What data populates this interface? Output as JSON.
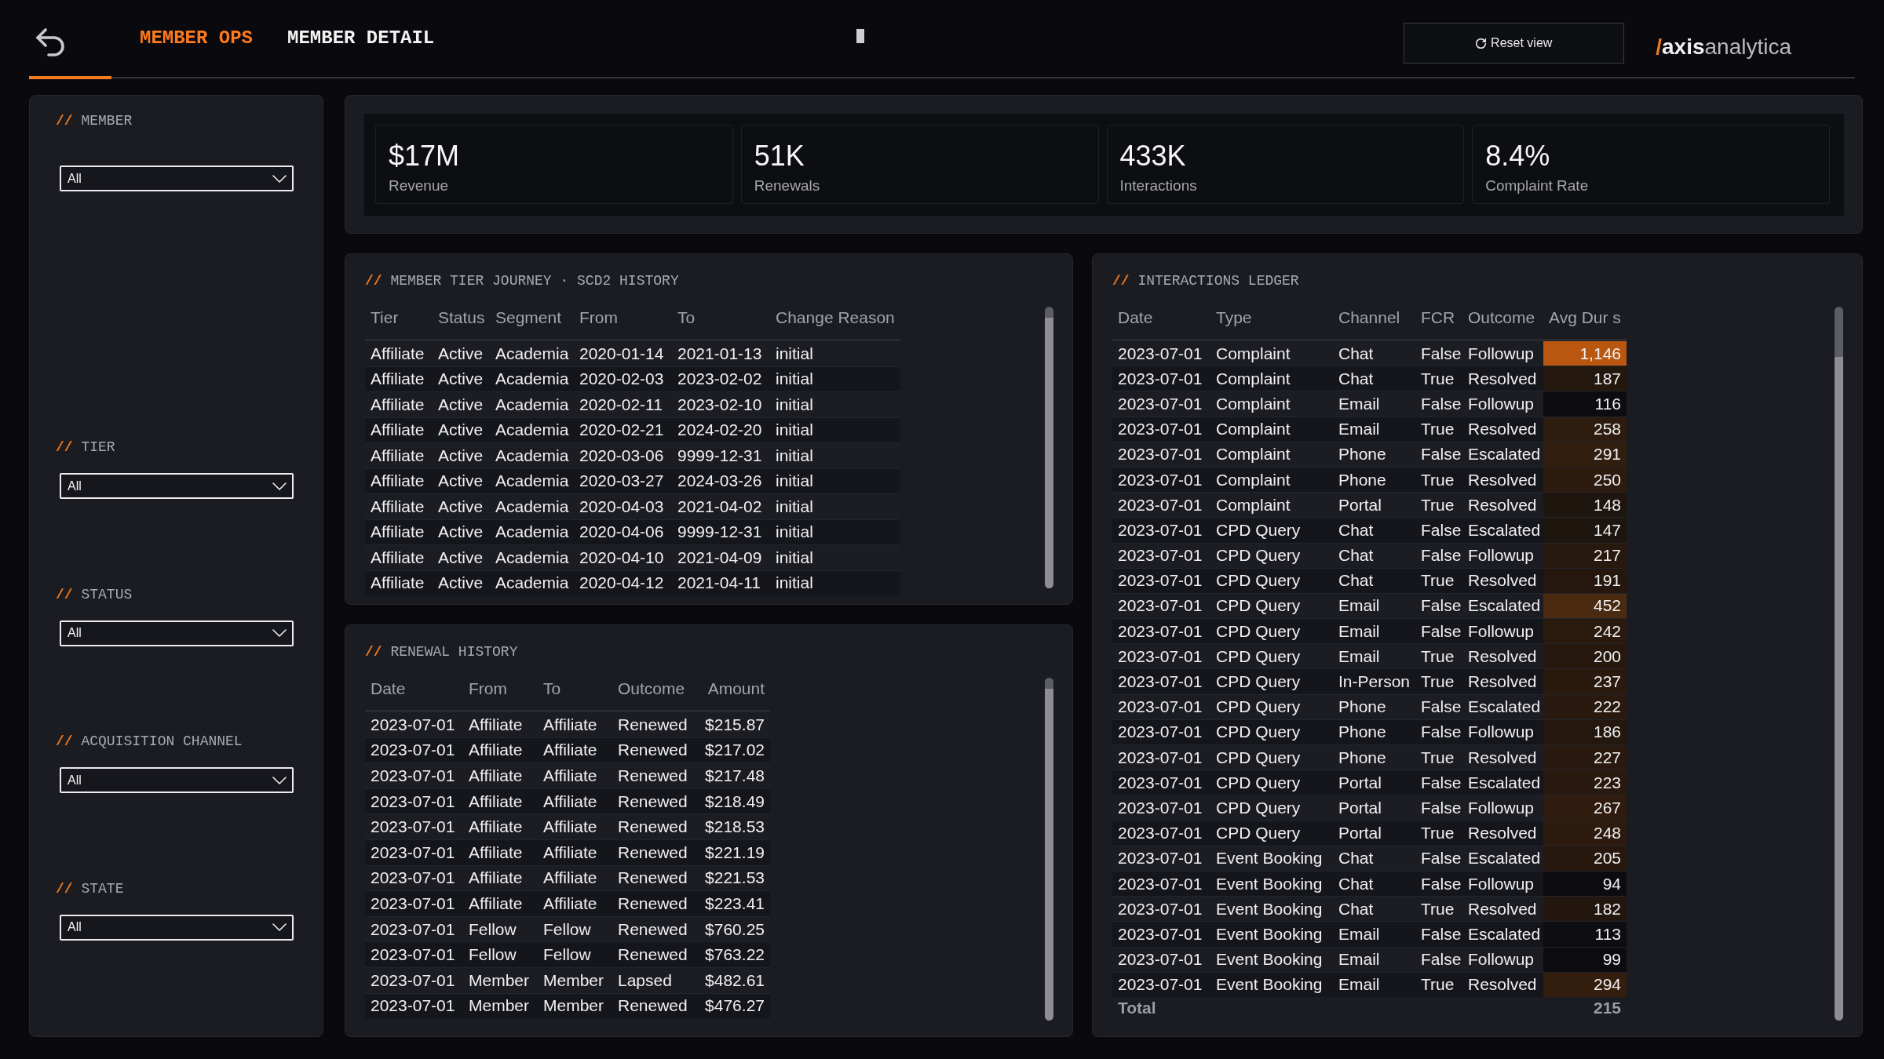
{
  "header": {
    "tabs": [
      {
        "label": "MEMBER OPS",
        "selected": true
      },
      {
        "label": "MEMBER DETAIL",
        "selected": false
      }
    ],
    "reset_button": {
      "label": "Reset view"
    },
    "logo": {
      "mark": "/",
      "bold": "axis",
      "light": "analytica"
    }
  },
  "filters": [
    {
      "marker": "//",
      "label": "MEMBER",
      "value": "All"
    },
    {
      "marker": "//",
      "label": "TIER",
      "value": "All"
    },
    {
      "marker": "//",
      "label": "STATUS",
      "value": "All"
    },
    {
      "marker": "//",
      "label": "ACQUISITION CHANNEL",
      "value": "All"
    },
    {
      "marker": "//",
      "label": "STATE",
      "value": "All"
    }
  ],
  "kpis": [
    {
      "value": "$17M",
      "label": "Revenue"
    },
    {
      "value": "51K",
      "label": "Renewals"
    },
    {
      "value": "433K",
      "label": "Interactions"
    },
    {
      "value": "8.4%",
      "label": "Complaint Rate"
    }
  ],
  "tier_journey": {
    "marker": "//",
    "title": "MEMBER TIER JOURNEY · SCD2 HISTORY",
    "columns": [
      "Tier",
      "Status",
      "Segment",
      "From",
      "To",
      "Change Reason"
    ],
    "rows": [
      [
        "Affiliate",
        "Active",
        "Academia",
        "2020-01-14",
        "2021-01-13",
        "initial"
      ],
      [
        "Affiliate",
        "Active",
        "Academia",
        "2020-02-03",
        "2023-02-02",
        "initial"
      ],
      [
        "Affiliate",
        "Active",
        "Academia",
        "2020-02-11",
        "2023-02-10",
        "initial"
      ],
      [
        "Affiliate",
        "Active",
        "Academia",
        "2020-02-21",
        "2024-02-20",
        "initial"
      ],
      [
        "Affiliate",
        "Active",
        "Academia",
        "2020-03-06",
        "9999-12-31",
        "initial"
      ],
      [
        "Affiliate",
        "Active",
        "Academia",
        "2020-03-27",
        "2024-03-26",
        "initial"
      ],
      [
        "Affiliate",
        "Active",
        "Academia",
        "2020-04-03",
        "2021-04-02",
        "initial"
      ],
      [
        "Affiliate",
        "Active",
        "Academia",
        "2020-04-06",
        "9999-12-31",
        "initial"
      ],
      [
        "Affiliate",
        "Active",
        "Academia",
        "2020-04-10",
        "2021-04-09",
        "initial"
      ],
      [
        "Affiliate",
        "Active",
        "Academia",
        "2020-04-12",
        "2021-04-11",
        "initial"
      ]
    ]
  },
  "renewal_history": {
    "marker": "//",
    "title": "RENEWAL HISTORY",
    "columns": [
      "Date",
      "From",
      "To",
      "Outcome",
      "Amount"
    ],
    "rows": [
      [
        "2023-07-01",
        "Affiliate",
        "Affiliate",
        "Renewed",
        "$215.87"
      ],
      [
        "2023-07-01",
        "Affiliate",
        "Affiliate",
        "Renewed",
        "$217.02"
      ],
      [
        "2023-07-01",
        "Affiliate",
        "Affiliate",
        "Renewed",
        "$217.48"
      ],
      [
        "2023-07-01",
        "Affiliate",
        "Affiliate",
        "Renewed",
        "$218.49"
      ],
      [
        "2023-07-01",
        "Affiliate",
        "Affiliate",
        "Renewed",
        "$218.53"
      ],
      [
        "2023-07-01",
        "Affiliate",
        "Affiliate",
        "Renewed",
        "$221.19"
      ],
      [
        "2023-07-01",
        "Affiliate",
        "Affiliate",
        "Renewed",
        "$221.53"
      ],
      [
        "2023-07-01",
        "Affiliate",
        "Affiliate",
        "Renewed",
        "$223.41"
      ],
      [
        "2023-07-01",
        "Fellow",
        "Fellow",
        "Renewed",
        "$760.25"
      ],
      [
        "2023-07-01",
        "Fellow",
        "Fellow",
        "Renewed",
        "$763.22"
      ],
      [
        "2023-07-01",
        "Member",
        "Member",
        "Lapsed",
        "$482.61"
      ],
      [
        "2023-07-01",
        "Member",
        "Member",
        "Renewed",
        "$476.27"
      ]
    ]
  },
  "interactions_ledger": {
    "marker": "//",
    "title": "INTERACTIONS LEDGER",
    "columns": [
      "Date",
      "Type",
      "Channel",
      "FCR",
      "Outcome",
      "Avg Dur s"
    ],
    "rows": [
      {
        "cells": [
          "2023-07-01",
          "Complaint",
          "Chat",
          "False",
          "Followup",
          "1,146"
        ],
        "color": "#b9560f"
      },
      {
        "cells": [
          "2023-07-01",
          "Complaint",
          "Chat",
          "True",
          "Resolved",
          "187"
        ],
        "color": "#24170e"
      },
      {
        "cells": [
          "2023-07-01",
          "Complaint",
          "Email",
          "False",
          "Followup",
          "116"
        ],
        "color": "#0d0d11"
      },
      {
        "cells": [
          "2023-07-01",
          "Complaint",
          "Email",
          "True",
          "Resolved",
          "258"
        ],
        "color": "#2e1c0e"
      },
      {
        "cells": [
          "2023-07-01",
          "Complaint",
          "Phone",
          "False",
          "Escalated",
          "291"
        ],
        "color": "#321e0e"
      },
      {
        "cells": [
          "2023-07-01",
          "Complaint",
          "Phone",
          "True",
          "Resolved",
          "250"
        ],
        "color": "#2c1b0e"
      },
      {
        "cells": [
          "2023-07-01",
          "Complaint",
          "Portal",
          "True",
          "Resolved",
          "148"
        ],
        "color": "#1f150f"
      },
      {
        "cells": [
          "2023-07-01",
          "CPD Query",
          "Chat",
          "False",
          "Escalated",
          "147"
        ],
        "color": "#1f150f"
      },
      {
        "cells": [
          "2023-07-01",
          "CPD Query",
          "Chat",
          "False",
          "Followup",
          "217"
        ],
        "color": "#28190e"
      },
      {
        "cells": [
          "2023-07-01",
          "CPD Query",
          "Chat",
          "True",
          "Resolved",
          "191"
        ],
        "color": "#25170e"
      },
      {
        "cells": [
          "2023-07-01",
          "CPD Query",
          "Email",
          "False",
          "Escalated",
          "452"
        ],
        "color": "#4a2a10"
      },
      {
        "cells": [
          "2023-07-01",
          "CPD Query",
          "Email",
          "False",
          "Followup",
          "242"
        ],
        "color": "#2b1b0e"
      },
      {
        "cells": [
          "2023-07-01",
          "CPD Query",
          "Email",
          "True",
          "Resolved",
          "200"
        ],
        "color": "#26180e"
      },
      {
        "cells": [
          "2023-07-01",
          "CPD Query",
          "In-Person",
          "True",
          "Resolved",
          "237"
        ],
        "color": "#2a1a0e"
      },
      {
        "cells": [
          "2023-07-01",
          "CPD Query",
          "Phone",
          "False",
          "Escalated",
          "222"
        ],
        "color": "#29190e"
      },
      {
        "cells": [
          "2023-07-01",
          "CPD Query",
          "Phone",
          "False",
          "Followup",
          "186"
        ],
        "color": "#24170e"
      },
      {
        "cells": [
          "2023-07-01",
          "CPD Query",
          "Phone",
          "True",
          "Resolved",
          "227"
        ],
        "color": "#29190e"
      },
      {
        "cells": [
          "2023-07-01",
          "CPD Query",
          "Portal",
          "False",
          "Escalated",
          "223"
        ],
        "color": "#29190e"
      },
      {
        "cells": [
          "2023-07-01",
          "CPD Query",
          "Portal",
          "False",
          "Followup",
          "267"
        ],
        "color": "#2f1c0e"
      },
      {
        "cells": [
          "2023-07-01",
          "CPD Query",
          "Portal",
          "True",
          "Resolved",
          "248"
        ],
        "color": "#2c1b0e"
      },
      {
        "cells": [
          "2023-07-01",
          "Event Booking",
          "Chat",
          "False",
          "Escalated",
          "205"
        ],
        "color": "#27180e"
      },
      {
        "cells": [
          "2023-07-01",
          "Event Booking",
          "Chat",
          "False",
          "Followup",
          "94"
        ],
        "color": "#0c0c10"
      },
      {
        "cells": [
          "2023-07-01",
          "Event Booking",
          "Chat",
          "True",
          "Resolved",
          "182"
        ],
        "color": "#23160e"
      },
      {
        "cells": [
          "2023-07-01",
          "Event Booking",
          "Email",
          "False",
          "Escalated",
          "113"
        ],
        "color": "#0e0d11"
      },
      {
        "cells": [
          "2023-07-01",
          "Event Booking",
          "Email",
          "False",
          "Followup",
          "99"
        ],
        "color": "#0c0c10"
      },
      {
        "cells": [
          "2023-07-01",
          "Event Booking",
          "Email",
          "True",
          "Resolved",
          "294"
        ],
        "color": "#331e0e"
      }
    ],
    "total": {
      "label": "Total",
      "value": "215"
    }
  }
}
